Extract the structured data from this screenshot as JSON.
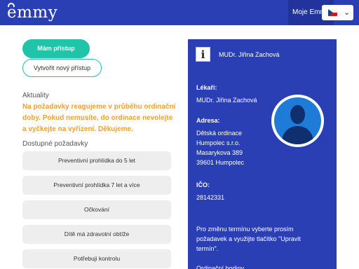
{
  "header": {
    "logo_text": "emmy",
    "nav_label": "Moje Emmy",
    "language_flag": "cz-flag-icon"
  },
  "actions": {
    "primary_label": "Mám přístup",
    "secondary_label": "Vytvořit nový přístup"
  },
  "news": {
    "title": "Aktuality",
    "text": "Na požadavky reagujeme v průběhu ordinační doby. Pokud nemusíte, do ordinace nevolejte a vyčkejte na vyřízení. Děkujeme."
  },
  "requests": {
    "title": "Dostupné požadavky",
    "items": [
      "Preventivní prohlídka do 5 let",
      "Preventivní prohlídka 7 let a více",
      "Očkování",
      "Dítě má zdravotní obtíže",
      "Potřebuji kontrolu"
    ]
  },
  "info_panel": {
    "heading": "MUDr. Jiřina Zachová",
    "doctor_label": "Lékaři:",
    "doctor_name": "MUDr. Jiřina Zachová",
    "address_label": "Adresa:",
    "address_lines": [
      "Dětská ordinace",
      "Humpolec s.r.o.",
      "Masarykova 389",
      "39601 Humpolec"
    ],
    "ico_label": "IČO:",
    "ico_value": "28142331",
    "note_lines": [
      "Pro změnu termínu vyberte prosím",
      "požadavek a využijte tlačítko \"Upravit",
      "termín\"."
    ],
    "hours_label": "Ordinační hodiny"
  },
  "colors": {
    "brand_blue": "#2b3fb5",
    "accent_teal": "#20c4a9",
    "notice_orange": "#f0a030"
  }
}
